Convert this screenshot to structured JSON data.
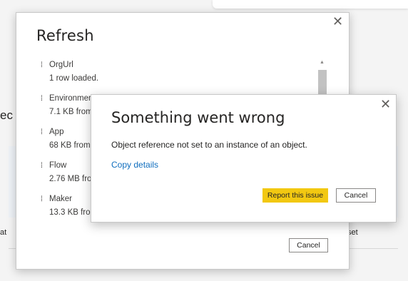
{
  "background": {
    "left_fragment_1": "ec",
    "left_fragment_2": "at",
    "right_fragment": "set"
  },
  "refresh_dialog": {
    "title": "Refresh",
    "close_glyph": "✕",
    "items": [
      {
        "name": "OrgUrl",
        "status": "1 row loaded."
      },
      {
        "name": "Environment",
        "status": "7.1 KB from"
      },
      {
        "name": "App",
        "status": "68 KB from"
      },
      {
        "name": "Flow",
        "status": "2.76 MB fro"
      },
      {
        "name": "Maker",
        "status": "13.3 KB fro"
      }
    ],
    "cancel_label": "Cancel"
  },
  "error_dialog": {
    "title": "Something went wrong",
    "close_glyph": "✕",
    "message": "Object reference not set to an instance of an object.",
    "copy_details_label": "Copy details",
    "report_label": "Report this issue",
    "cancel_label": "Cancel"
  },
  "colors": {
    "primary_button": "#f2c811",
    "link": "#106ebe"
  },
  "icons": {
    "item_status": "spinner-icon",
    "close": "close-icon",
    "scroll_up": "chevron-up-icon"
  }
}
